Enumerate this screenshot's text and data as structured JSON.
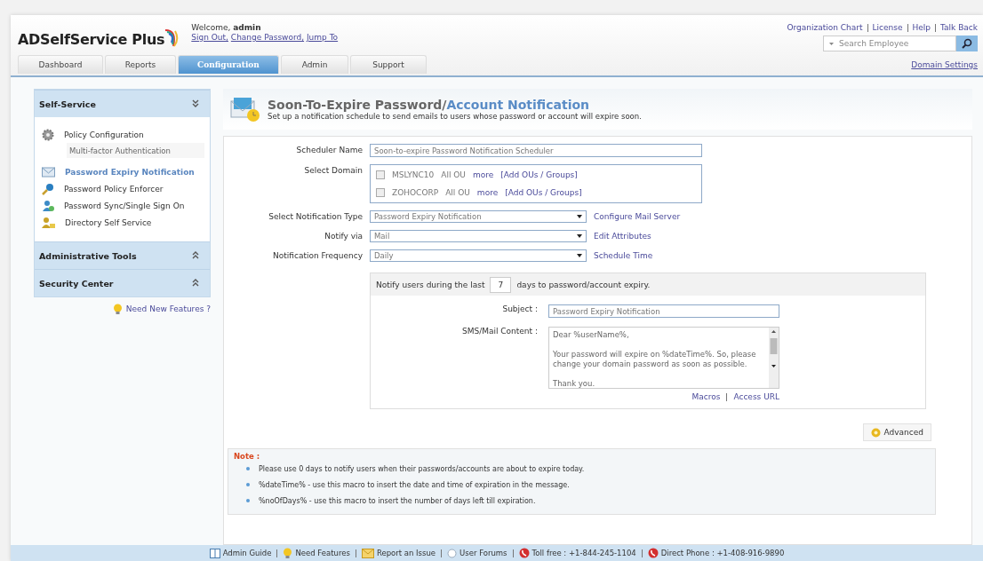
{
  "header": {
    "logo": "ADSelfService Plus",
    "welcome": "Welcome,",
    "user": "admin",
    "links": [
      "Sign Out,",
      "Change Password,",
      "Jump To"
    ],
    "top_links": [
      "Organization Chart",
      "License",
      "Help",
      "Talk Back"
    ],
    "search": {
      "placeholder": "Search Employee"
    },
    "domain_settings": "Domain Settings"
  },
  "tabs": [
    {
      "label": "Dashboard",
      "selected": false
    },
    {
      "label": "Reports",
      "selected": false
    },
    {
      "label": "Configuration",
      "selected": true
    },
    {
      "label": "Admin",
      "selected": false
    },
    {
      "label": "Support",
      "selected": false
    }
  ],
  "sidebar": {
    "sections": [
      {
        "title": "Self-Service",
        "expanded": true,
        "items": [
          {
            "label": "Policy Configuration",
            "kind": "gear",
            "selected": false,
            "children": [
              {
                "label": "Multi-factor Authentication",
                "selected": false
              }
            ]
          },
          {
            "label": "Password Expiry Notification",
            "kind": "mail",
            "selected": true
          },
          {
            "label": "Password Policy Enforcer",
            "kind": "key",
            "selected": false
          },
          {
            "label": "Password Sync/Single Sign On",
            "kind": "sync",
            "selected": false
          },
          {
            "label": "Directory Self Service",
            "kind": "directory",
            "selected": false
          }
        ]
      },
      {
        "title": "Administrative Tools",
        "expanded": false
      },
      {
        "title": "Security Center",
        "expanded": false
      }
    ],
    "need_features": "Need New Features ?"
  },
  "page": {
    "title": "Soon-To-Expire Password/",
    "title_highlight": "Account Notification",
    "subtitle": "Set up a notification schedule to send emails to users whose password or account will expire soon."
  },
  "form": {
    "scheduler": {
      "label": "Scheduler Name",
      "value": "Soon-to-expire Password Notification Scheduler"
    },
    "domain_label": "Select Domain",
    "domains": [
      {
        "name": "MSLYNC10",
        "checked": false,
        "ou": "All OU",
        "more": "more",
        "add": "[Add OUs / Groups]"
      },
      {
        "name": "ZOHOCORP",
        "checked": false,
        "ou": "All OU",
        "more": "more",
        "add": "[Add OUs / Groups]"
      }
    ],
    "selects": [
      {
        "label": "Select Notification Type",
        "value": "Password Expiry Notification",
        "link": "Configure Mail Server"
      },
      {
        "label": "Notify via",
        "value": "Mail",
        "link": "Edit Attributes"
      },
      {
        "label": "Notification Frequency",
        "value": "Daily",
        "link": "Schedule Time"
      }
    ],
    "notify": {
      "prefix": "Notify users during the last",
      "days": "7",
      "suffix": "days to password/account expiry.",
      "subject_label": "Subject :",
      "subject": "Password Expiry Notification",
      "content_label": "SMS/Mail Content :",
      "content": [
        "Dear %userName%,",
        "Your password will expire on %dateTime%. So, please change your domain password as soon as possible.",
        "Thank you."
      ],
      "links": [
        "Macros",
        "Access URL"
      ]
    },
    "advanced": "Advanced"
  },
  "note": {
    "title": "Note :",
    "items": [
      "Please use 0 days to notify users when their passwords/accounts are about to expire today.",
      "%dateTime% - use this macro to insert the date and time of expiration in the message.",
      "%noOfDays% - use this macro to insert the number of days left till expiration."
    ]
  },
  "footer": [
    {
      "label": "Admin Guide",
      "kind": "book"
    },
    {
      "label": "Need Features",
      "kind": "bulb"
    },
    {
      "label": "Report an Issue",
      "kind": "mail"
    },
    {
      "label": "User Forums",
      "kind": "forum"
    },
    {
      "label": "Toll free : +1-844-245-1104",
      "kind": "phone"
    },
    {
      "label": "Direct Phone : +1-408-916-9890",
      "kind": "phone"
    }
  ]
}
